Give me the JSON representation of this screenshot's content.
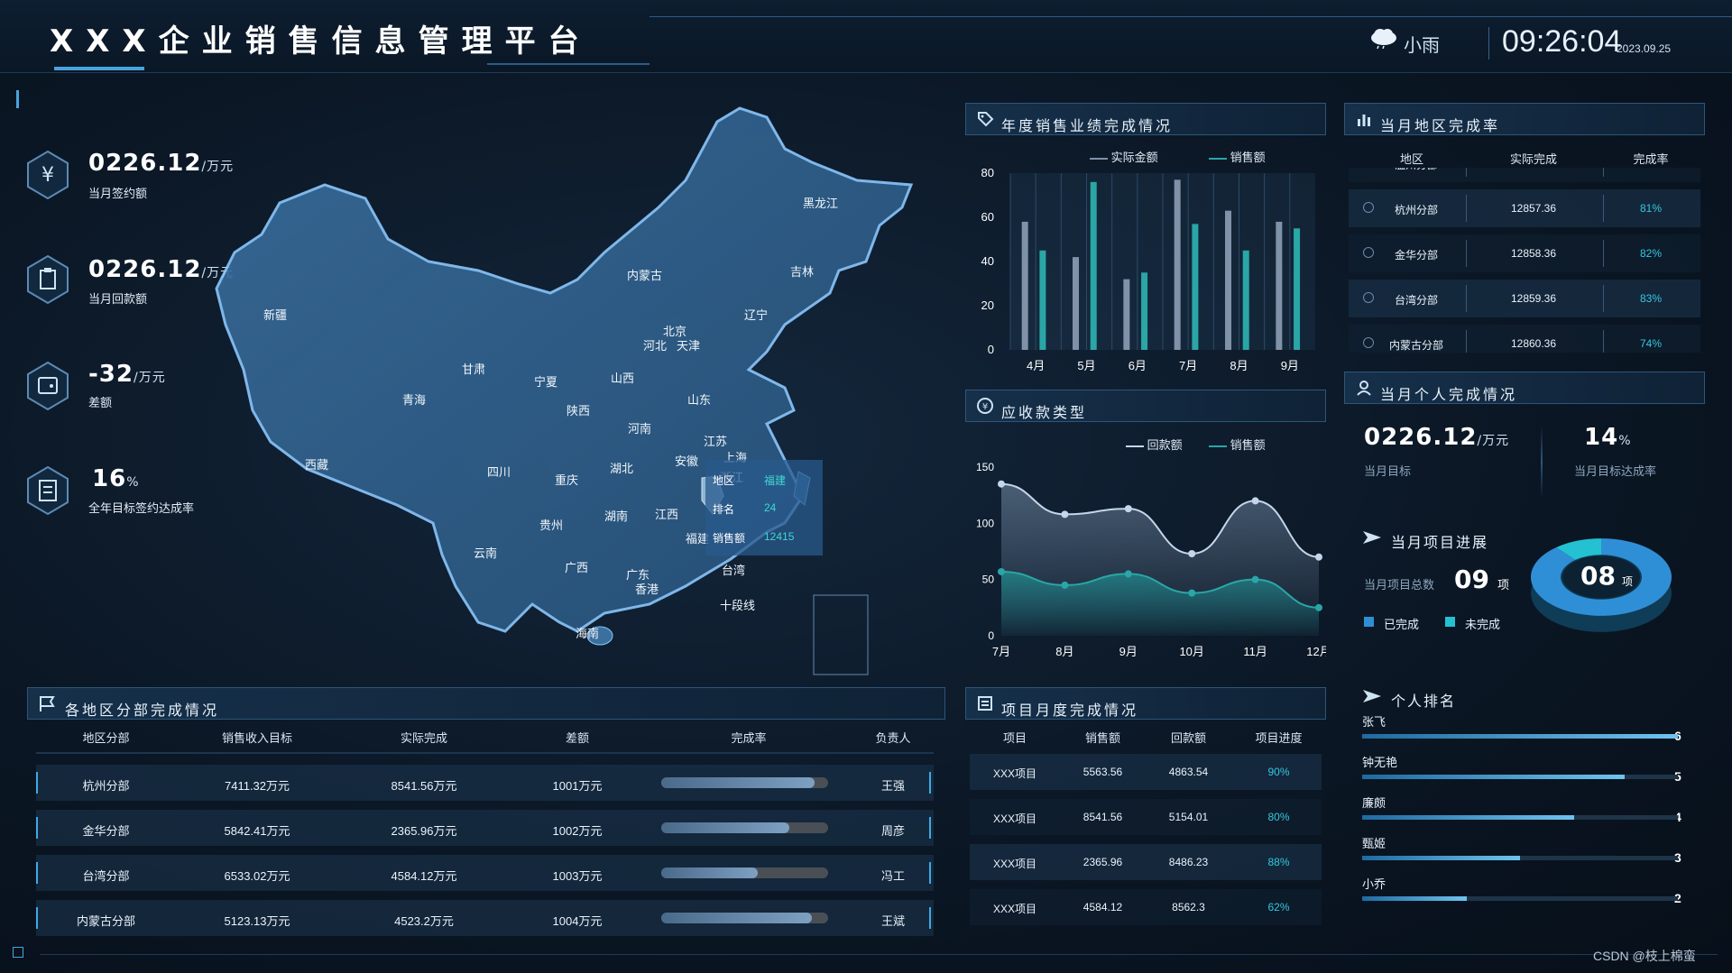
{
  "header": {
    "title": "XXX企业销售信息管理平台",
    "weather": "小雨",
    "time": "09:26:04",
    "date": "2023.09.25"
  },
  "kpis": [
    {
      "value": "0226.12",
      "unit": "/万元",
      "label": "当月签约额",
      "icon": "yen-icon"
    },
    {
      "value": "0226.12",
      "unit": "/万元",
      "label": "当月回款额",
      "icon": "clipboard-icon"
    },
    {
      "value": "-32",
      "unit": "/万元",
      "label": "差额",
      "icon": "wallet-icon"
    },
    {
      "value": "16",
      "unit": "%",
      "label": "全年目标签约达成率",
      "icon": "document-icon"
    }
  ],
  "map": {
    "provinces": [
      "黑龙江",
      "吉林",
      "辽宁",
      "内蒙古",
      "新疆",
      "北京",
      "天津",
      "河北",
      "甘肃",
      "宁夏",
      "山西",
      "山东",
      "青海",
      "陕西",
      "河南",
      "江苏",
      "西藏",
      "四川",
      "重庆",
      "湖北",
      "安徽",
      "浙江",
      "贵州",
      "湖南",
      "江西",
      "福建",
      "云南",
      "广西",
      "广东",
      "香港",
      "台湾",
      "海南",
      "上海",
      "十段线"
    ],
    "tooltip": {
      "region_label": "地区",
      "region": "福建",
      "rank_label": "排名",
      "rank": "24",
      "sales_label": "销售额",
      "sales": "12415"
    }
  },
  "region_table": {
    "title": "各地区分部完成情况",
    "headers": [
      "地区分部",
      "销售收入目标",
      "实际完成",
      "差额",
      "完成率",
      "负责人"
    ],
    "rows": [
      {
        "region": "杭州分部",
        "target": "7411.32万元",
        "actual": "8541.56万元",
        "diff": "1001万元",
        "rate": 0.92,
        "owner": "王强"
      },
      {
        "region": "金华分部",
        "target": "5842.41万元",
        "actual": "2365.96万元",
        "diff": "1002万元",
        "rate": 0.77,
        "owner": "周彦"
      },
      {
        "region": "台湾分部",
        "target": "6533.02万元",
        "actual": "4584.12万元",
        "diff": "1003万元",
        "rate": 0.58,
        "owner": "冯工"
      },
      {
        "region": "内蒙古分部",
        "target": "5123.13万元",
        "actual": "4523.2万元",
        "diff": "1004万元",
        "rate": 0.9,
        "owner": "王斌"
      }
    ]
  },
  "annual_chart": {
    "title": "年度销售业绩完成情况",
    "chart_data": {
      "type": "bar",
      "categories": [
        "4月",
        "5月",
        "6月",
        "7月",
        "8月",
        "9月"
      ],
      "series": [
        {
          "name": "实际金额",
          "values": [
            58,
            42,
            32,
            77,
            63,
            58
          ]
        },
        {
          "name": "销售额",
          "values": [
            45,
            76,
            35,
            57,
            45,
            55
          ]
        }
      ],
      "ylim": [
        0,
        80
      ],
      "yticks": [
        0,
        20,
        40,
        60,
        80
      ]
    }
  },
  "receivable_chart": {
    "title": "应收款类型",
    "chart_data": {
      "type": "line",
      "categories": [
        "7月",
        "8月",
        "9月",
        "10月",
        "11月",
        "12月"
      ],
      "series": [
        {
          "name": "回款额",
          "values": [
            135,
            108,
            113,
            73,
            120,
            70
          ]
        },
        {
          "name": "销售额",
          "values": [
            57,
            45,
            55,
            38,
            50,
            25
          ]
        }
      ],
      "ylim": [
        0,
        150
      ],
      "yticks": [
        0,
        50,
        100,
        150
      ]
    }
  },
  "region_rate": {
    "title": "当月地区完成率",
    "headers": [
      "地区",
      "实际完成",
      "完成率"
    ],
    "rows": [
      {
        "region": "温州分部",
        "actual": "12856.36",
        "rate": "80%"
      },
      {
        "region": "杭州分部",
        "actual": "12857.36",
        "rate": "81%"
      },
      {
        "region": "金华分部",
        "actual": "12858.36",
        "rate": "82%"
      },
      {
        "region": "台湾分部",
        "actual": "12859.36",
        "rate": "83%"
      },
      {
        "region": "内蒙古分部",
        "actual": "12860.36",
        "rate": "74%"
      }
    ]
  },
  "personal": {
    "title": "当月个人完成情况",
    "target_value": "0226.12",
    "target_unit": "/万元",
    "target_label": "当月目标",
    "rate_value": "14",
    "rate_unit": "%",
    "rate_label": "当月目标达成率",
    "progress_title": "当月项目进展",
    "total_label": "当月项目总数",
    "total_value": "09",
    "total_unit": "项",
    "donut_value": "08",
    "donut_unit": "项",
    "done_label": "已完成",
    "undone_label": "未完成",
    "done_fraction": 0.89,
    "colors": {
      "done": "#2f8fd6",
      "undone": "#24c1d2"
    }
  },
  "project_table": {
    "title": "项目月度完成情况",
    "headers": [
      "项目",
      "销售额",
      "回款额",
      "项目进度"
    ],
    "rows": [
      {
        "name": "XXX项目",
        "sales": "5563.56",
        "payback": "4863.54",
        "progress": "90%"
      },
      {
        "name": "XXX项目",
        "sales": "8541.56",
        "payback": "5154.01",
        "progress": "80%"
      },
      {
        "name": "XXX项目",
        "sales": "2365.96",
        "payback": "8486.23",
        "progress": "88%"
      },
      {
        "name": "XXX项目",
        "sales": "4584.12",
        "payback": "8562.3",
        "progress": "62%"
      }
    ]
  },
  "ranking": {
    "title": "个人排名",
    "items": [
      {
        "name": "张飞",
        "value": "6",
        "fraction": 1.0
      },
      {
        "name": "钟无艳",
        "value": "5",
        "fraction": 0.83
      },
      {
        "name": "廉颇",
        "value": "4",
        "fraction": 0.67
      },
      {
        "name": "甄姬",
        "value": "3",
        "fraction": 0.5
      },
      {
        "name": "小乔",
        "value": "2",
        "fraction": 0.33
      }
    ]
  },
  "footer": {
    "watermark": "CSDN @枝上棉蛮"
  }
}
